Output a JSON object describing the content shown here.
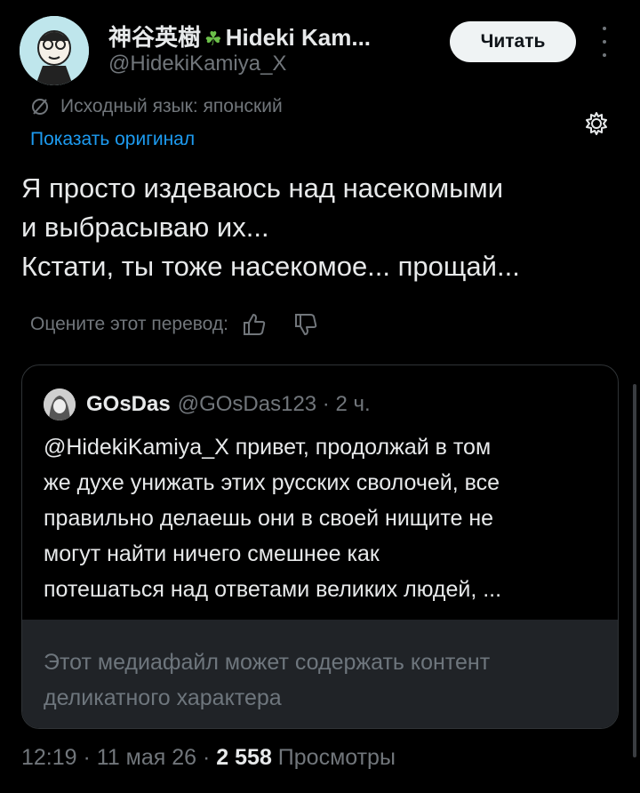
{
  "author": {
    "display_name": "神谷英樹",
    "clover": "☘",
    "name_latin": "Hideki Kam...",
    "handle": "@HidekiKamiya_X"
  },
  "follow_button": "Читать",
  "more_icon": "more-vertical-icon",
  "translation": {
    "source_language": "Исходный язык: японский",
    "show_original": "Показать оригинал",
    "settings_icon": "gear-icon"
  },
  "tweet_lines": [
    "Я просто издеваюсь над насекомыми",
    "и выбрасываю их...",
    "Кстати, ты тоже насекомое... прощай..."
  ],
  "rate": {
    "label": "Оцените этот перевод:",
    "like_icon": "thumbs-up-icon",
    "dislike_icon": "thumbs-down-icon"
  },
  "quote": {
    "name": "GOsDas",
    "handle_time": "@GOsDas123 · 2 ч.",
    "lines": [
      "@HidekiKamiya_X привет, продолжай в том",
      "же духе унижать этих русских сволочей, все",
      "правильно делаешь они в своей нищите не",
      "могут найти ничего смешнее как",
      "потешаться над ответами великих людей, ..."
    ],
    "sensitive_lines": [
      "Этот медиафайл может содержать контент",
      "деликатного характера"
    ]
  },
  "footer": {
    "datetime": "12:19 · 11 мая 26 · ",
    "views_count": "2 558",
    "views_label": " Просмотры"
  },
  "colors": {
    "background": "#000000",
    "text": "#e7e9ea",
    "muted": "#71767b",
    "link": "#1d9bf0"
  }
}
